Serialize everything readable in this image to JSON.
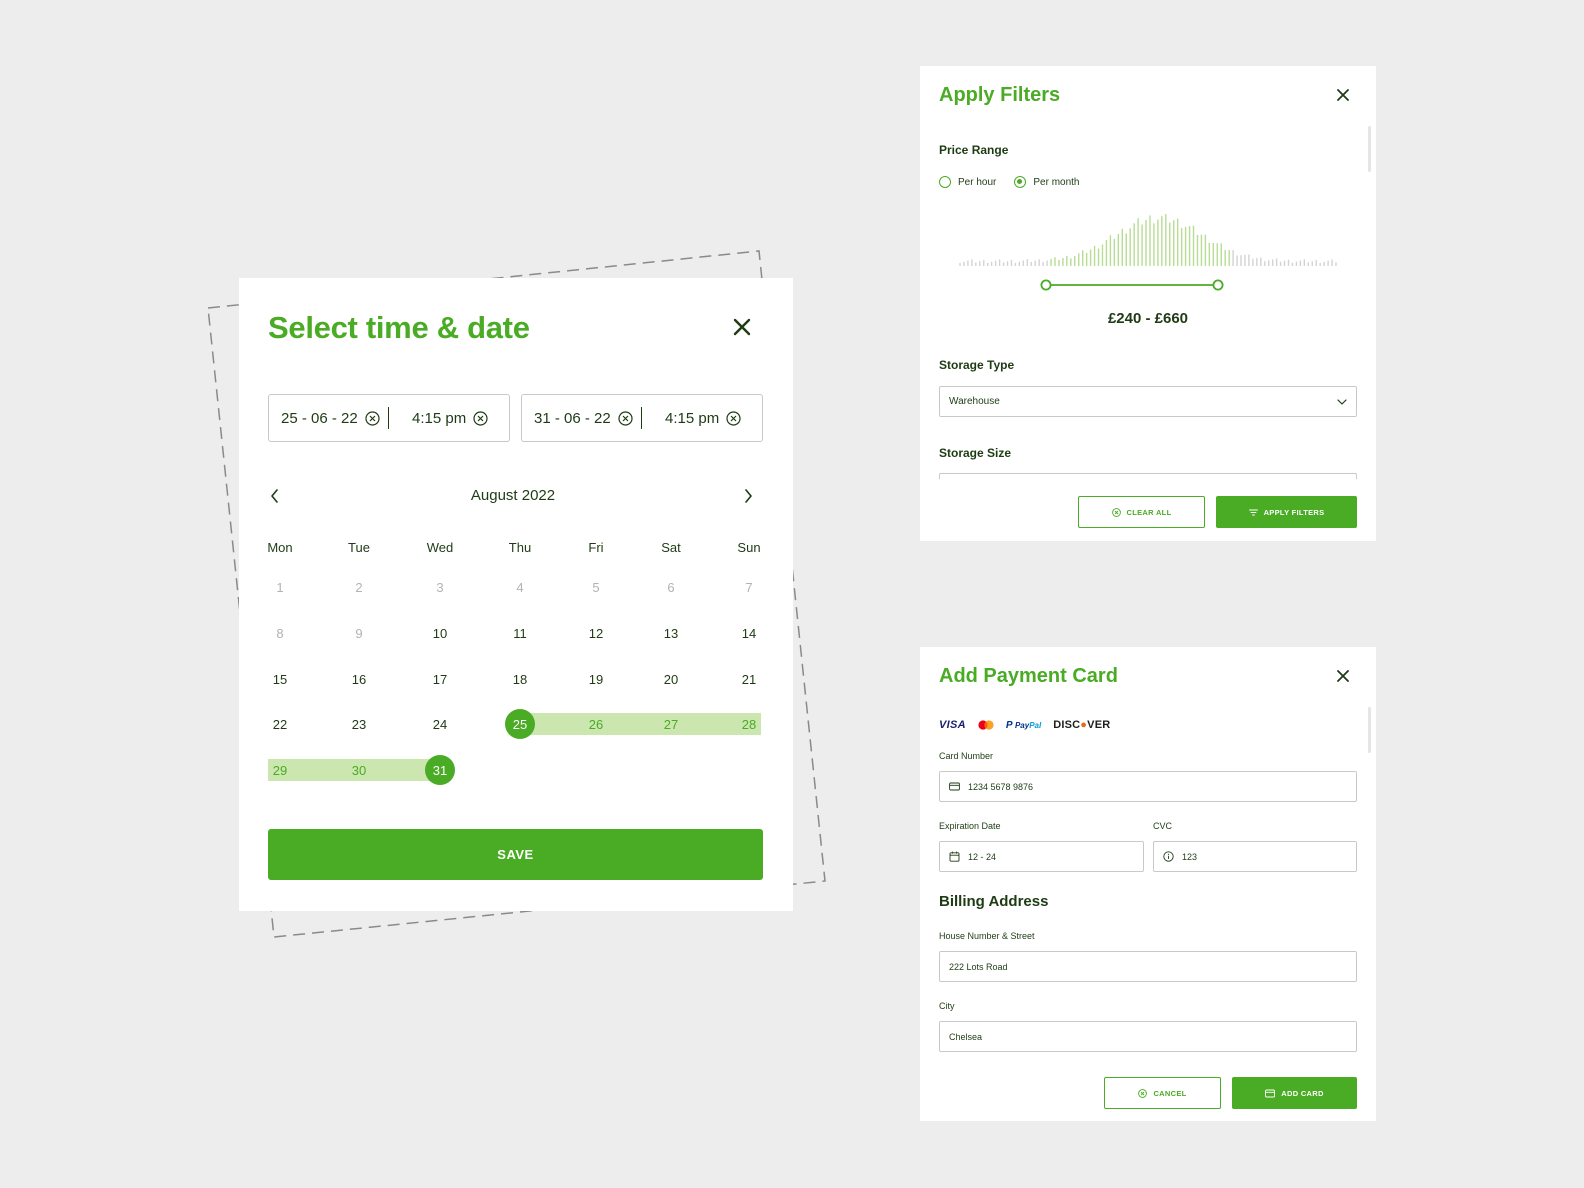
{
  "date_picker": {
    "title": "Select time & date",
    "range_start": {
      "date": "25 - 06 - 22",
      "time": "4:15 pm"
    },
    "range_end": {
      "date": "31 - 06 - 22",
      "time": "4:15 pm"
    },
    "month_label": "August 2022",
    "weekdays": [
      "Mon",
      "Tue",
      "Wed",
      "Thu",
      "Fri",
      "Sat",
      "Sun"
    ],
    "weeks": [
      [
        {
          "d": "1",
          "s": "muted"
        },
        {
          "d": "2",
          "s": "muted"
        },
        {
          "d": "3",
          "s": "muted"
        },
        {
          "d": "4",
          "s": "muted"
        },
        {
          "d": "5",
          "s": "muted"
        },
        {
          "d": "6",
          "s": "muted"
        },
        {
          "d": "7",
          "s": "muted"
        }
      ],
      [
        {
          "d": "8",
          "s": "muted"
        },
        {
          "d": "9",
          "s": "muted"
        },
        {
          "d": "10",
          "s": ""
        },
        {
          "d": "11",
          "s": ""
        },
        {
          "d": "12",
          "s": ""
        },
        {
          "d": "13",
          "s": ""
        },
        {
          "d": "14",
          "s": ""
        }
      ],
      [
        {
          "d": "15",
          "s": ""
        },
        {
          "d": "16",
          "s": ""
        },
        {
          "d": "17",
          "s": ""
        },
        {
          "d": "18",
          "s": ""
        },
        {
          "d": "19",
          "s": ""
        },
        {
          "d": "20",
          "s": ""
        },
        {
          "d": "21",
          "s": ""
        }
      ],
      [
        {
          "d": "22",
          "s": ""
        },
        {
          "d": "23",
          "s": ""
        },
        {
          "d": "24",
          "s": ""
        },
        {
          "d": "25",
          "s": "selected"
        },
        {
          "d": "26",
          "s": "inrange"
        },
        {
          "d": "27",
          "s": "inrange"
        },
        {
          "d": "28",
          "s": "inrange"
        }
      ],
      [
        {
          "d": "29",
          "s": "inrange"
        },
        {
          "d": "30",
          "s": "inrange"
        },
        {
          "d": "31",
          "s": "selected"
        }
      ]
    ],
    "save_label": "SAVE",
    "icons": {
      "close": "close-icon",
      "prev": "chevron-left-icon",
      "next": "chevron-right-icon",
      "clear": "x-circle-icon"
    }
  },
  "filters": {
    "title": "Apply Filters",
    "price_range_label": "Price Range",
    "radio_options": [
      {
        "label": "Per hour",
        "selected": false
      },
      {
        "label": "Per month",
        "selected": true
      }
    ],
    "price_value": "£240 - £660",
    "storage_type_label": "Storage Type",
    "storage_type_value": "Warehouse",
    "storage_size_label": "Storage Size",
    "clear_all_label": "CLEAR ALL",
    "apply_label": "APPLY FILTERS",
    "icons": {
      "close": "close-icon",
      "select": "chevron-down-icon",
      "clear": "x-circle-icon",
      "apply": "filter-icon"
    }
  },
  "payment": {
    "title": "Add Payment Card",
    "brands": {
      "visa": "VISA",
      "paypal_a": "Pay",
      "paypal_b": "Pal",
      "discover_a": "DISC",
      "discover_b": "VER"
    },
    "card_number_label": "Card Number",
    "card_number_value": "1234 5678 9876",
    "expiration_label": "Expiration Date",
    "expiration_value": "12 - 24",
    "cvc_label": "CVC",
    "cvc_value": "123",
    "billing_title": "Billing Address",
    "street_label": "House Number & Street",
    "street_value": "222 Lots Road",
    "city_label": "City",
    "city_value": "Chelsea",
    "cancel_label": "CANCEL",
    "add_card_label": "ADD CARD",
    "icons": {
      "close": "close-icon",
      "card": "credit-card-icon",
      "calendar": "calendar-icon",
      "info": "info-icon"
    }
  },
  "colors": {
    "brand_green": "#4aab24",
    "range_green": "#cce6b0",
    "text_dark": "#1e3b14",
    "muted": "#b3b3b3",
    "background": "#ededed"
  }
}
